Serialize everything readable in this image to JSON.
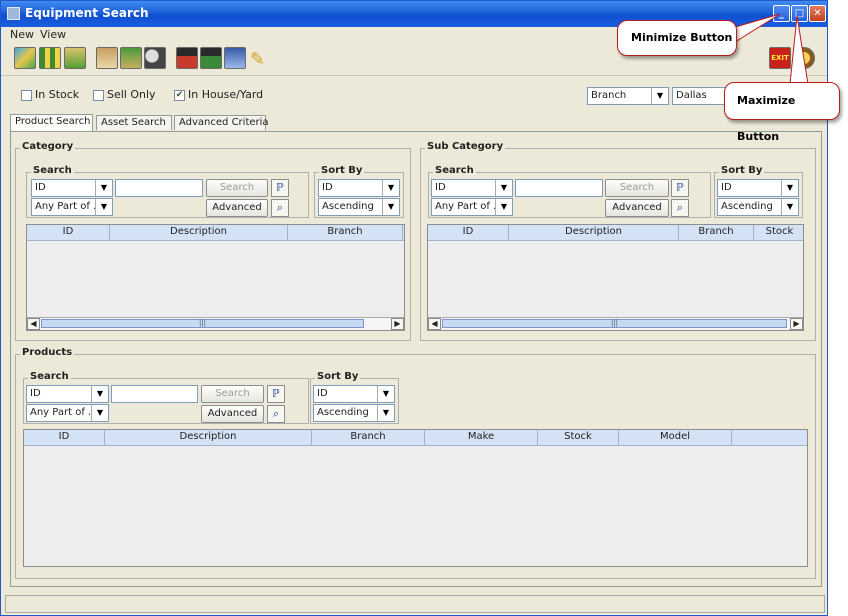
{
  "window": {
    "title": "Equipment Search",
    "menu": [
      "New",
      "View"
    ]
  },
  "toolbar": {
    "icons": [
      "multi-color-icon",
      "grid-icon",
      "chart-icon",
      "clipboard-icon",
      "box-icon",
      "cubes-help-icon",
      "asset-icon",
      "asset-list-icon",
      "report-icon",
      "pencil-icon",
      "exit-icon",
      "help-icon"
    ],
    "exit_label": "EXIT"
  },
  "filters": {
    "in_stock": {
      "label": "In Stock",
      "checked": false
    },
    "sell_only": {
      "label": "Sell Only",
      "checked": false
    },
    "in_house": {
      "label": "In House/Yard",
      "checked": true
    },
    "location_type": "Branch",
    "location_value": "Dallas"
  },
  "tabs": [
    "Product Search",
    "Asset Search",
    "Advanced Criteria"
  ],
  "category": {
    "title": "Category",
    "search_title": "Search",
    "field": "ID",
    "match": "Any Part of ...",
    "search_label": "Search",
    "advanced_label": "Advanced",
    "sortby_title": "Sort By",
    "sort_field": "ID",
    "sort_order": "Ascending",
    "columns": [
      "ID",
      "Description",
      "Branch"
    ]
  },
  "subcategory": {
    "title": "Sub Category",
    "search_title": "Search",
    "field": "ID",
    "match": "Any Part of ...",
    "search_label": "Search",
    "advanced_label": "Advanced",
    "sortby_title": "Sort By",
    "sort_field": "ID",
    "sort_order": "Ascending",
    "columns": [
      "ID",
      "Description",
      "Branch",
      "Stock"
    ]
  },
  "products": {
    "title": "Products",
    "search_title": "Search",
    "field": "ID",
    "match": "Any Part of ...",
    "search_label": "Search",
    "advanced_label": "Advanced",
    "sortby_title": "Sort By",
    "sort_field": "ID",
    "sort_order": "Ascending",
    "columns": [
      "ID",
      "Description",
      "Branch",
      "Make",
      "Stock",
      "Model"
    ]
  },
  "annotations": {
    "minimize": "Minimize Button",
    "maximize": "Maximize Button"
  },
  "scroll_thumb": "|||"
}
